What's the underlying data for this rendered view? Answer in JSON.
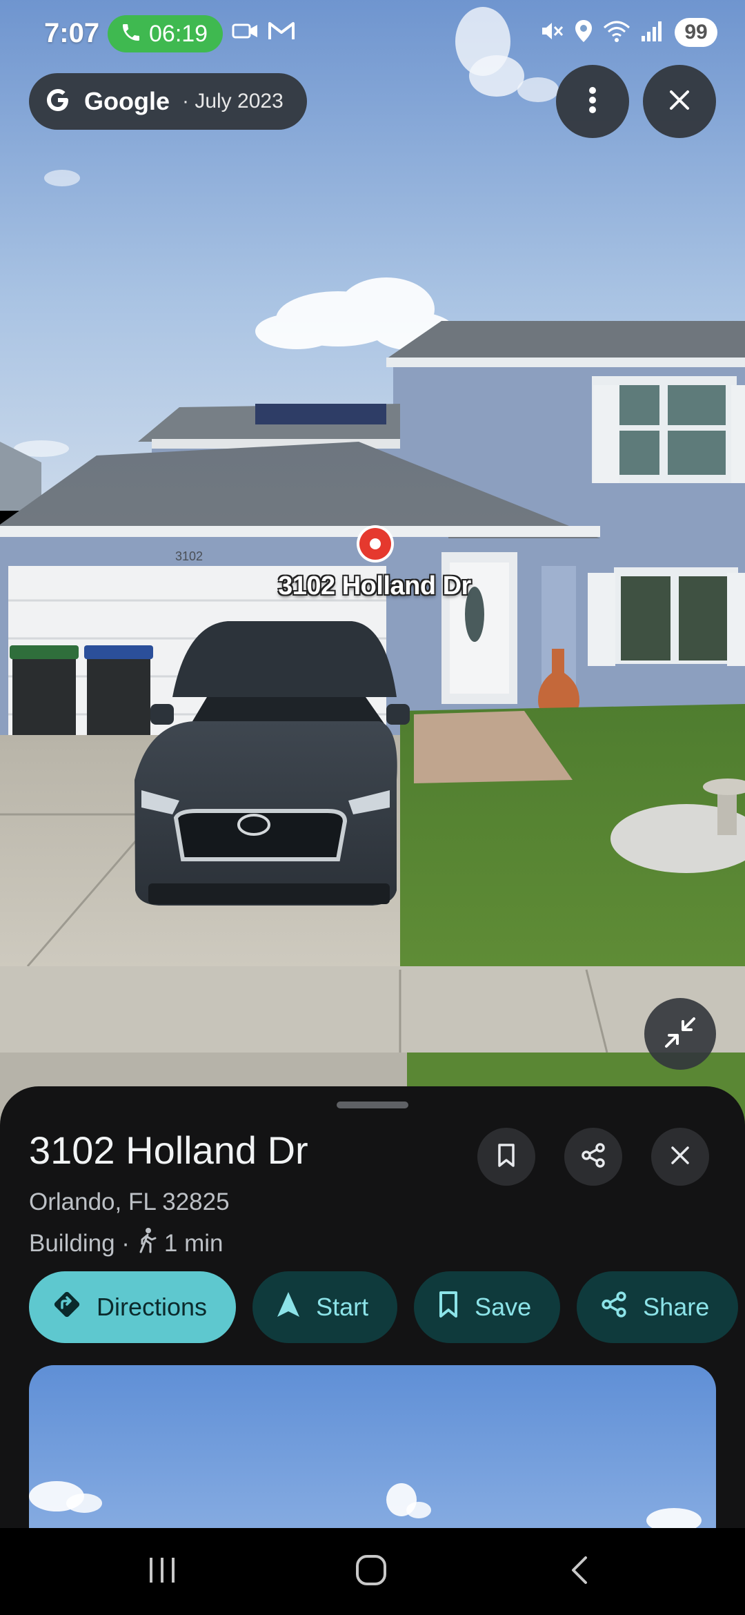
{
  "status_bar": {
    "time": "7:07",
    "call_timer": "06:19",
    "battery": "99",
    "icons": [
      "phone-icon",
      "video-icon",
      "gmail-icon",
      "mute-icon",
      "location-icon",
      "wifi-icon",
      "signal-icon"
    ]
  },
  "source_chip": {
    "brand": "Google",
    "date": "· July 2023"
  },
  "map": {
    "place_label": "3102 Holland Dr",
    "house_number": "3102"
  },
  "sheet": {
    "title": "3102 Holland Dr",
    "address": "Orlando, FL 32825",
    "category": "Building ·",
    "walk_time": "1 min",
    "actions": [
      {
        "label": "Directions",
        "icon": "directions-icon"
      },
      {
        "label": "Start",
        "icon": "navigation-arrow-icon"
      },
      {
        "label": "Save",
        "icon": "bookmark-icon"
      },
      {
        "label": "Share",
        "icon": "share-icon"
      }
    ]
  },
  "colors": {
    "primary_chip": "#5ec8cf",
    "secondary_chip": "#0f3a3c",
    "sheet_bg": "#131314",
    "call_green": "#3fb950",
    "pin_red": "#e5392e"
  }
}
